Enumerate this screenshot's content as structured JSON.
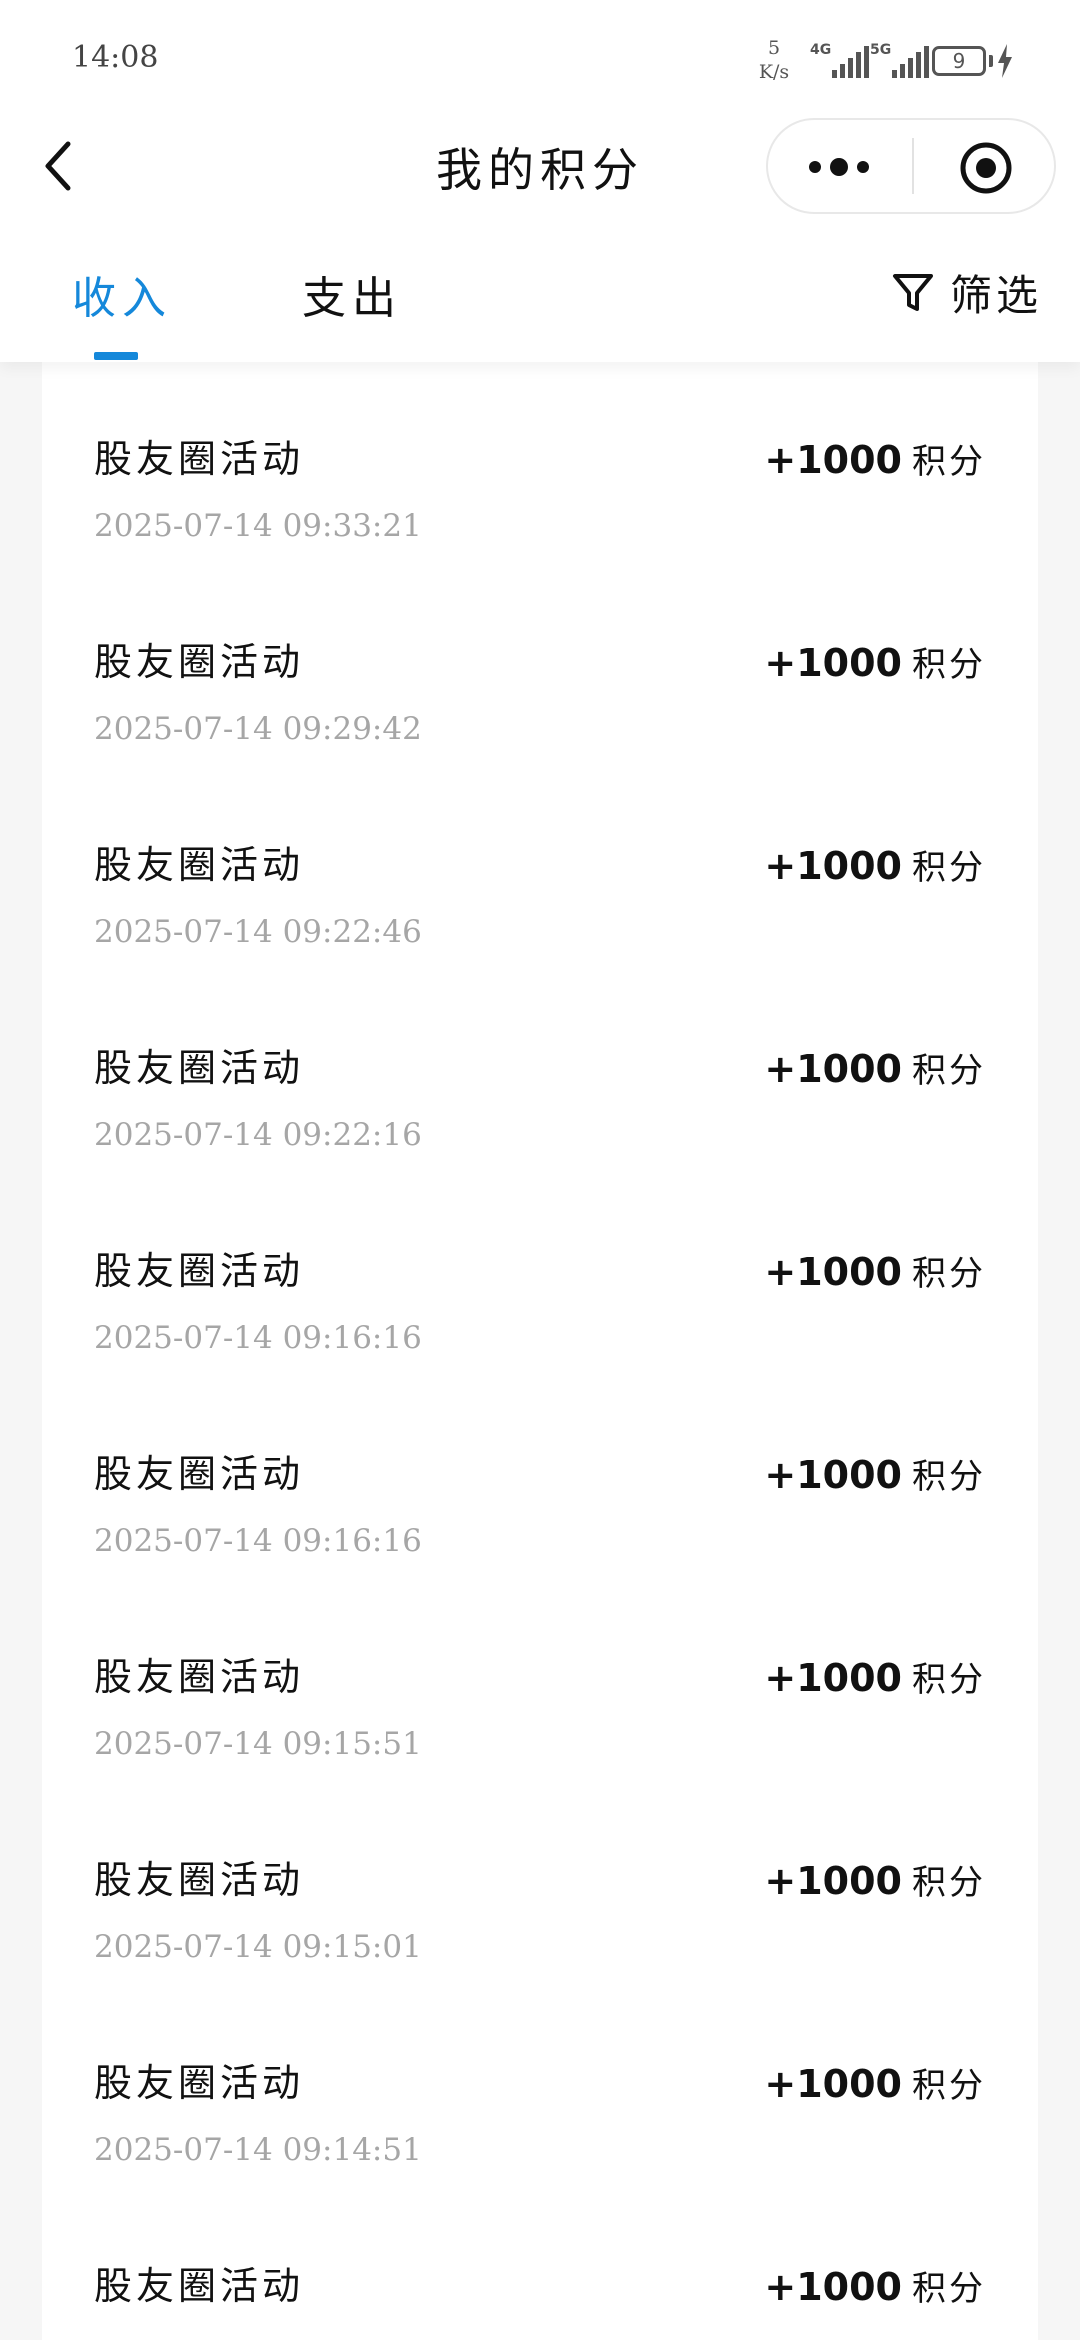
{
  "status_bar": {
    "time": "14:08",
    "net_speed_value": "5",
    "net_speed_unit": "K/s",
    "signal_1_label": "4G",
    "signal_2_label": "5G",
    "battery_level": "9"
  },
  "nav": {
    "title": "我的积分"
  },
  "tabs": {
    "income": "收入",
    "expense": "支出",
    "filter": "筛选"
  },
  "records": [
    {
      "title": "股友圈活动",
      "time": "2025-07-14 09:33:21",
      "points": "+1000",
      "unit": "积分"
    },
    {
      "title": "股友圈活动",
      "time": "2025-07-14 09:29:42",
      "points": "+1000",
      "unit": "积分"
    },
    {
      "title": "股友圈活动",
      "time": "2025-07-14 09:22:46",
      "points": "+1000",
      "unit": "积分"
    },
    {
      "title": "股友圈活动",
      "time": "2025-07-14 09:22:16",
      "points": "+1000",
      "unit": "积分"
    },
    {
      "title": "股友圈活动",
      "time": "2025-07-14 09:16:16",
      "points": "+1000",
      "unit": "积分"
    },
    {
      "title": "股友圈活动",
      "time": "2025-07-14 09:16:16",
      "points": "+1000",
      "unit": "积分"
    },
    {
      "title": "股友圈活动",
      "time": "2025-07-14 09:15:51",
      "points": "+1000",
      "unit": "积分"
    },
    {
      "title": "股友圈活动",
      "time": "2025-07-14 09:15:01",
      "points": "+1000",
      "unit": "积分"
    },
    {
      "title": "股友圈活动",
      "time": "2025-07-14 09:14:51",
      "points": "+1000",
      "unit": "积分"
    },
    {
      "title": "股友圈活动",
      "time": "",
      "points": "+1000",
      "unit": "积分"
    }
  ],
  "colors": {
    "accent": "#1588da",
    "timestamp": "#a6a6a6",
    "background": "#f6f6f6"
  },
  "icons": {
    "back": "chevron-left-icon",
    "more": "more-dots-icon",
    "close": "target-icon",
    "filter": "filter-funnel-icon",
    "charging": "bolt-icon"
  }
}
